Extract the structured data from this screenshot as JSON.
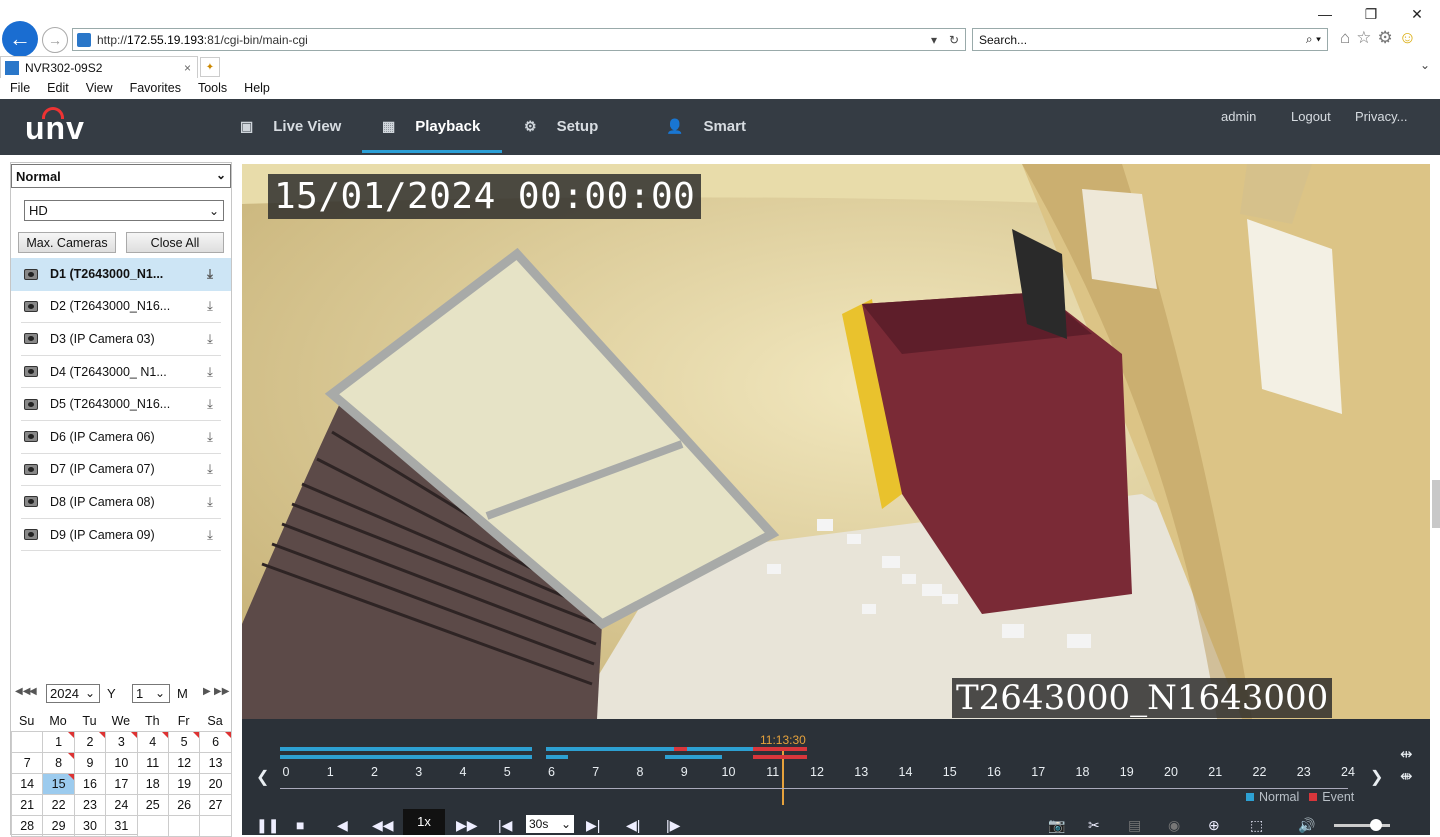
{
  "browser": {
    "url_prefix": "http://",
    "url_host": "172.55.19.193",
    "url_rest": ":81/cgi-bin/main-cgi",
    "search_placeholder": "Search...",
    "tab_title": "NVR302-09S2",
    "menu": [
      "File",
      "Edit",
      "View",
      "Favorites",
      "Tools",
      "Help"
    ]
  },
  "app": {
    "logo": "unv",
    "nav": [
      {
        "label": "Live View",
        "icon": "monitor-icon"
      },
      {
        "label": "Playback",
        "icon": "playback-icon"
      },
      {
        "label": "Setup",
        "icon": "gear-icon"
      },
      {
        "label": "Smart",
        "icon": "smart-person-icon"
      }
    ],
    "user": "admin",
    "logout": "Logout",
    "privacy": "Privacy..."
  },
  "left_panel": {
    "mode": "Normal",
    "quality": "HD",
    "max_cameras": "Max. Cameras",
    "close_all": "Close All",
    "cameras": [
      "D1 (T2643000_N1...",
      "D2 (T2643000_N16...",
      "D3 (IP Camera 03)",
      "D4 (T2643000_ N1...",
      "D5 (T2643000_N16...",
      "D6 (IP Camera 06)",
      "D7 (IP Camera 07)",
      "D8 (IP Camera 08)",
      "D9 (IP Camera 09)"
    ],
    "selected_camera_index": 0
  },
  "calendar": {
    "year": "2024",
    "year_unit": "Y",
    "month": "1",
    "month_unit": "M",
    "weekdays": [
      "Su",
      "Mo",
      "Tu",
      "We",
      "Th",
      "Fr",
      "Sa"
    ],
    "first_weekday_index": 1,
    "days_in_month": 31,
    "selected_day": 15,
    "days_with_recording": [
      1,
      2,
      3,
      4,
      5,
      6,
      8,
      15
    ]
  },
  "video": {
    "osd_time": "15/01/2024 00:00:00",
    "osd_camera": "T2643000_N1643000"
  },
  "timeline": {
    "cursor_time": "11:13:30",
    "hour_labels": [
      "0",
      "1",
      "2",
      "3",
      "4",
      "5",
      "6",
      "7",
      "8",
      "9",
      "10",
      "11",
      "12",
      "13",
      "14",
      "15",
      "16",
      "17",
      "18",
      "19",
      "20",
      "21",
      "22",
      "23",
      "24"
    ],
    "legend_normal": "Normal",
    "legend_event": "Event",
    "colors": {
      "normal": "#2da0d2",
      "event": "#d8363b",
      "cursor": "#e6a23c"
    }
  },
  "controls": {
    "speed": "1x",
    "step": "30s"
  }
}
